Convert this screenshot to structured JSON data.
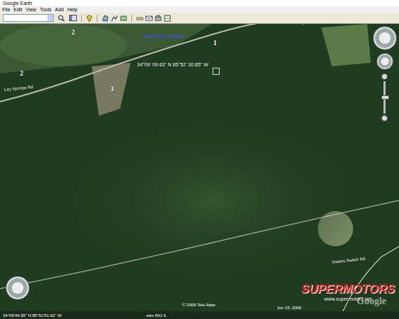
{
  "window": {
    "title": "Google Earth"
  },
  "menu": [
    "File",
    "Edit",
    "View",
    "Tools",
    "Add",
    "Help"
  ],
  "map": {
    "labels": [
      {
        "text": "Birch Rock Hollow",
        "kind": "place"
      },
      {
        "text": "1",
        "kind": "number"
      },
      {
        "text": "2",
        "kind": "number"
      },
      {
        "text": "2",
        "kind": "number"
      },
      {
        "text": "3",
        "kind": "number"
      },
      {
        "text": "Ley Springs Rd",
        "kind": "road"
      },
      {
        "text": "34°09' 09.63\" N 85°52' 30.85\" W",
        "kind": "coord"
      },
      {
        "text": "Owens Switch Rd",
        "kind": "road"
      }
    ]
  },
  "zoom": {
    "level": 0.5
  },
  "copyright": "© 2009 Tele Atlas",
  "date": "Jun 15, 2006",
  "logo": "Google",
  "watermark": {
    "brand": "SUPERMOTORS",
    "url": "www.supermotors.net"
  },
  "status_bar": {
    "pointer": "34°09'44.95\" N  85°51'51.62\" W",
    "elevation": "elev  841 ft"
  }
}
